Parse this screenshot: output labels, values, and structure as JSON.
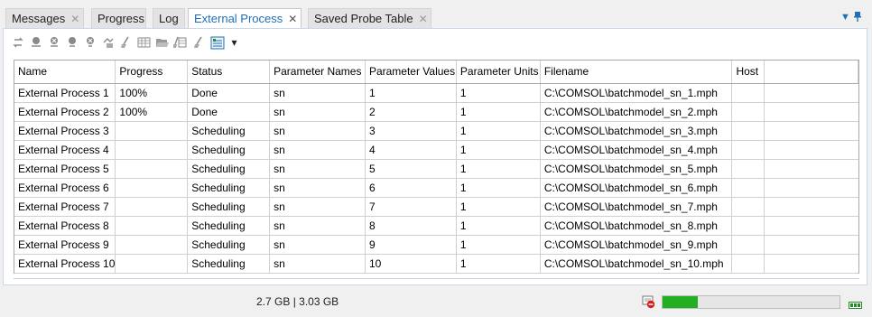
{
  "tabs": [
    {
      "label": "Messages",
      "closable": true,
      "active": false
    },
    {
      "label": "Progress",
      "closable": false,
      "active": false
    },
    {
      "label": "Log",
      "closable": false,
      "active": false
    },
    {
      "label": "External Process",
      "closable": true,
      "active": true
    },
    {
      "label": "Saved Probe Table",
      "closable": true,
      "active": false
    }
  ],
  "tab_close_glyph": "✕",
  "tab_controls": {
    "menu_glyph": "▼",
    "pin_glyph": "📌"
  },
  "toolbar": {
    "icons": [
      "refresh-icon",
      "run-icon",
      "cancel-icon",
      "stop-icon",
      "clear-icon",
      "attach-icon",
      "broom-icon",
      "table-icon",
      "open-folder-icon",
      "clear-table-icon",
      "broom-icon",
      "plot-icon"
    ],
    "dropdown_glyph": "▾"
  },
  "table": {
    "columns": [
      "Name",
      "Progress",
      "Status",
      "Parameter Names",
      "Parameter Values",
      "Parameter Units",
      "Filename",
      "Host"
    ],
    "rows": [
      [
        "External Process 1",
        "100%",
        "Done",
        "sn",
        "1",
        "1",
        "C:\\COMSOL\\batchmodel_sn_1.mph",
        ""
      ],
      [
        "External Process 2",
        "100%",
        "Done",
        "sn",
        "2",
        "1",
        "C:\\COMSOL\\batchmodel_sn_2.mph",
        ""
      ],
      [
        "External Process 3",
        "",
        "Scheduling",
        "sn",
        "3",
        "1",
        "C:\\COMSOL\\batchmodel_sn_3.mph",
        ""
      ],
      [
        "External Process 4",
        "",
        "Scheduling",
        "sn",
        "4",
        "1",
        "C:\\COMSOL\\batchmodel_sn_4.mph",
        ""
      ],
      [
        "External Process 5",
        "",
        "Scheduling",
        "sn",
        "5",
        "1",
        "C:\\COMSOL\\batchmodel_sn_5.mph",
        ""
      ],
      [
        "External Process 6",
        "",
        "Scheduling",
        "sn",
        "6",
        "1",
        "C:\\COMSOL\\batchmodel_sn_6.mph",
        ""
      ],
      [
        "External Process 7",
        "",
        "Scheduling",
        "sn",
        "7",
        "1",
        "C:\\COMSOL\\batchmodel_sn_7.mph",
        ""
      ],
      [
        "External Process 8",
        "",
        "Scheduling",
        "sn",
        "8",
        "1",
        "C:\\COMSOL\\batchmodel_sn_8.mph",
        ""
      ],
      [
        "External Process 9",
        "",
        "Scheduling",
        "sn",
        "9",
        "1",
        "C:\\COMSOL\\batchmodel_sn_9.mph",
        ""
      ],
      [
        "External Process 10",
        "",
        "Scheduling",
        "sn",
        "10",
        "1",
        "C:\\COMSOL\\batchmodel_sn_10.mph",
        ""
      ]
    ]
  },
  "status_bar": {
    "memory": "2.7 GB | 3.03 GB",
    "progress_fraction": 0.2,
    "progress_color": "#22b022"
  },
  "colors": {
    "accent": "#1f6fb5"
  }
}
